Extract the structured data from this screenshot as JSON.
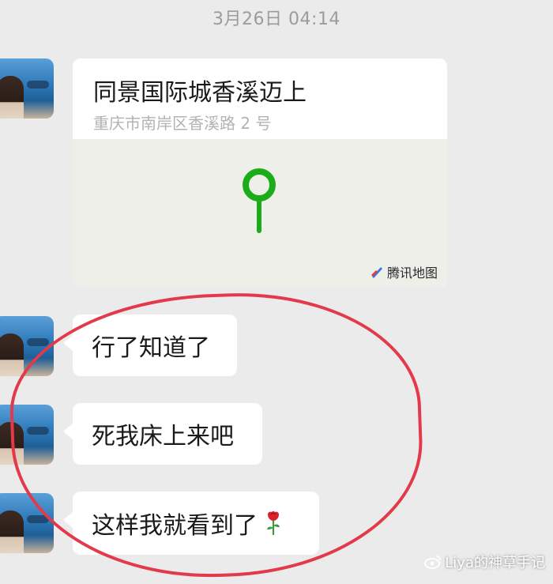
{
  "timestamp": "3月26日 04:14",
  "location": {
    "title": "同景国际城香溪迈上",
    "address": "重庆市南岸区香溪路 2 号",
    "map_brand": "腾讯地图",
    "pin_color": "#1aad19"
  },
  "messages": [
    {
      "text": "行了知道了"
    },
    {
      "text": "死我床上来吧"
    },
    {
      "text": "这样我就看到了",
      "emoji": "rose-icon"
    }
  ],
  "annotation_color": "#e23a4a",
  "watermark": "Liya的神草手记"
}
